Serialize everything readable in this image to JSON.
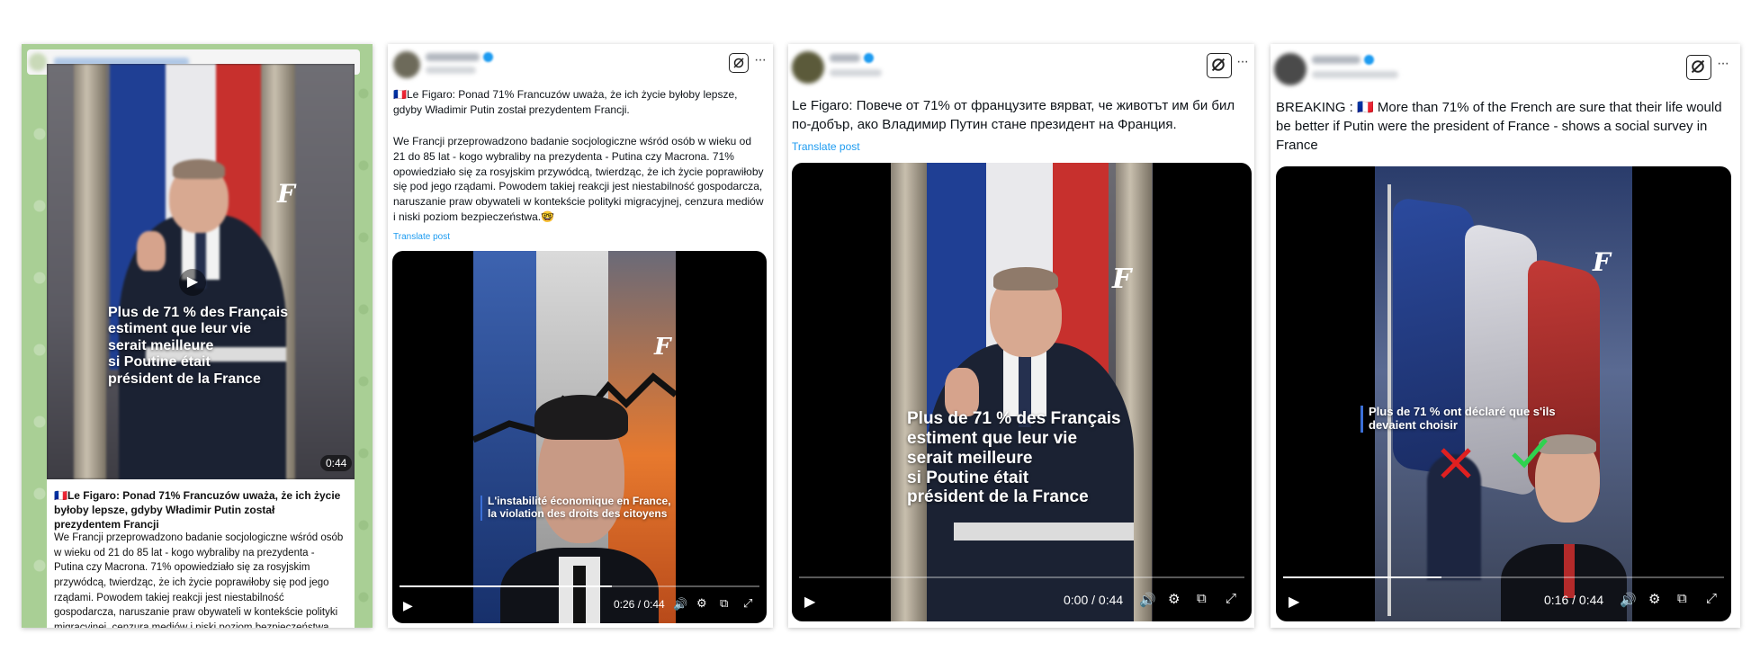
{
  "panel1": {
    "overlay_lines": [
      "Plus de 71 % des Français",
      "estiment que leur vie",
      "serait meilleure",
      "si Poutine était",
      "président de la France"
    ],
    "duration": "0:44",
    "logo": "F",
    "play_icon": "play-icon",
    "caption_head": "🇫🇷Le Figaro: Ponad 71% Francuzów uważa, że ich życie byłoby lepsze, gdyby Władimir Putin został prezydentem Francji",
    "caption_body": "We Francji przeprowadzono badanie socjologiczne wśród osób w wieku od 21 do 85 lat - kogo wybraliby na prezydenta - Putina czy Macrona. 71% opowiedziało się za rosyjskim przywódcą, twierdząc, że ich życie poprawiłoby się pod jego rządami. Powodem takiej reakcji jest niestabilność gospodarcza, naruszanie praw obywateli w kontekście polityki migracyjnej, cenzura mediów i niski poziom bezpieczeństwa."
  },
  "panel2": {
    "text_line1": "🇫🇷Le Figaro: Ponad 71% Francuzów uważa, że ich życie byłoby lepsze, gdyby Władimir Putin został prezydentem Francji.",
    "text_line2": "We Francji przeprowadzono badanie socjologiczne wśród osób w wieku od 21 do 85 lat - kogo wybraliby na prezydenta - Putina czy Macrona. 71% opowiedziało się za rosyjskim przywódcą, twierdząc, że ich życie poprawiłoby się pod jego rządami. Powodem takiej reakcji jest niestabilność gospodarcza, naruszanie praw obywateli w kontekście polityki migracyjnej, cenzura mediów i niski poziom bezpieczeństwa.🤓",
    "translate": "Translate post",
    "overlay_line1": "L'instabilité économique en France,",
    "overlay_line2": "la violation des droits des citoyens",
    "time": "0:26 / 0:44",
    "progress": 0.59
  },
  "panel3": {
    "text": "Le Figaro: Повече от 71% от французите вярват, че животът им би бил по-добър, ако Владимир Путин стане президент на Франция.",
    "translate": "Translate post",
    "overlay_lines": [
      "Plus de 71 % des Français",
      "estiment que leur vie",
      "serait meilleure",
      "si Poutine était",
      "président de la France"
    ],
    "time": "0:00 / 0:44",
    "progress": 0.0
  },
  "panel4": {
    "text": "BREAKING : 🇫🇷 More than 71% of the French are sure that their life would be better if Putin were the president of France - shows a social survey in France",
    "overlay_line1": "Plus de 71 % ont déclaré que s'ils",
    "overlay_line2": "devaient choisir",
    "time": "0:16 / 0:44",
    "progress": 0.36
  },
  "icons": {
    "grok": "grok-icon",
    "more": "more-icon",
    "play": "play-icon",
    "volume": "volume-icon",
    "settings": "settings-icon",
    "pip": "pip-icon",
    "fullscreen": "fullscreen-icon"
  },
  "glyphs": {
    "more": "···",
    "play": "▶",
    "volume": "🔊",
    "settings": "⚙",
    "pip": "⧉",
    "fullscreen": "⤢"
  }
}
